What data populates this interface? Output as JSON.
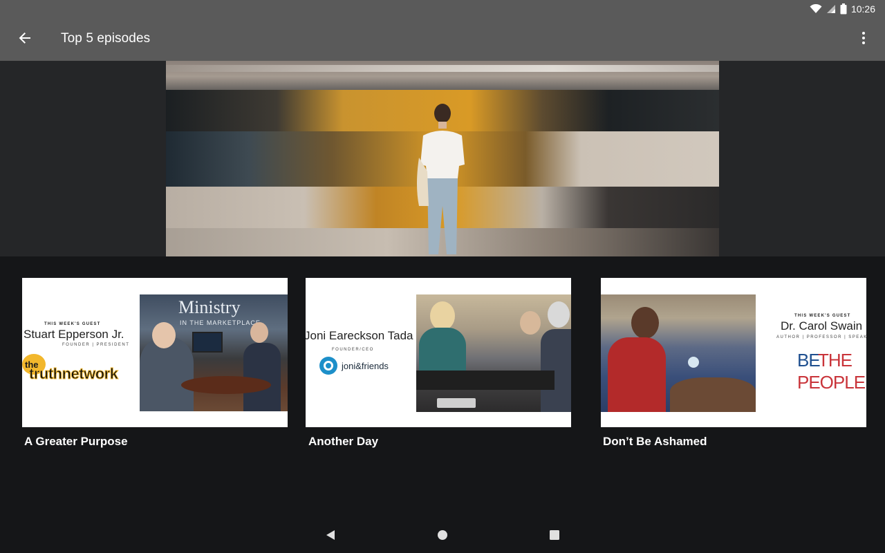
{
  "status_bar": {
    "time": "10:26",
    "icons": [
      "wifi-icon",
      "signal-icon",
      "battery-icon"
    ]
  },
  "app_bar": {
    "title": "Top 5 episodes",
    "back_icon": "arrow-back-icon",
    "menu_icon": "more-vert-icon"
  },
  "hero": {
    "description": "woman-on-train-platform"
  },
  "episodes": [
    {
      "title": "A Greater Purpose",
      "thumbnail": {
        "kicker": "THIS WEEK'S GUEST",
        "guest": "Stuart Epperson Jr.",
        "role": "FOUNDER | PRESIDENT",
        "logo": "thetruthnetwork",
        "logo_prefix": "the",
        "logo_text": "truthnetwork",
        "banner": "Ministry",
        "banner_sub": "IN THE MARKETPLACE"
      }
    },
    {
      "title": "Another Day",
      "thumbnail": {
        "kicker": "",
        "guest": "Joni Eareckson Tada",
        "role": "FOUNDER/CEO",
        "logo": "joni&friends",
        "logo_text": "joni&friends"
      }
    },
    {
      "title": "Don’t Be Ashamed",
      "thumbnail": {
        "kicker": "THIS WEEK'S GUEST",
        "guest": "Dr. Carol Swain",
        "role": "AUTHOR | PROFESSOR | SPEAKER",
        "logo": "BE THE PEOPLE",
        "logo_line1_a": "BE",
        "logo_line1_b": "THE",
        "logo_line2": "PEOPLE"
      }
    }
  ],
  "colors": {
    "app_bar": "#5a5a5a",
    "background": "#151618",
    "hero_band": "#252628",
    "accent_red": "#c9343a",
    "accent_blue": "#1e4f8f",
    "truth_yellow": "#f2b72c"
  },
  "nav_bar": {
    "icons": [
      "back-triangle-icon",
      "home-circle-icon",
      "recents-square-icon"
    ]
  }
}
